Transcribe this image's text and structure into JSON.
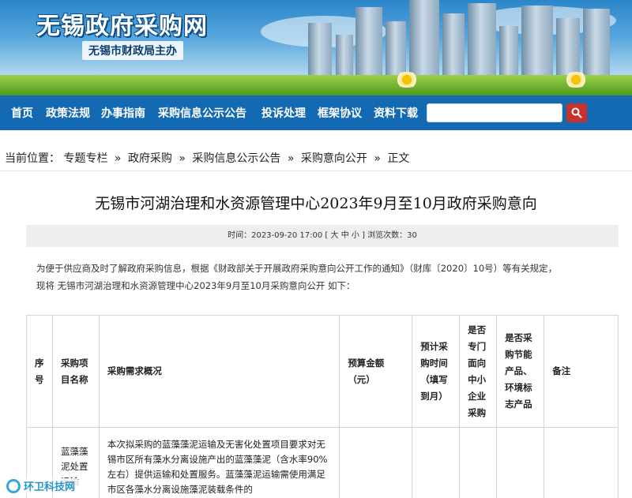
{
  "header": {
    "site_title": "无锡政府采购网",
    "site_subtitle": "无锡市财政局主办"
  },
  "nav": {
    "items": [
      "首页",
      "政策法规",
      "办事指南",
      "采购信息公示公告",
      "投诉处理",
      "框架协议",
      "资料下载"
    ],
    "search_placeholder": "",
    "search_icon": "search-icon"
  },
  "breadcrumb": {
    "prefix": "当前位置：",
    "items": [
      "专题专栏",
      "政府采购",
      "采购信息公示公告",
      "采购意向公开",
      "正文"
    ],
    "separator": "»"
  },
  "article": {
    "title": "无锡市河湖治理和水资源管理中心2023年9月至10月政府采购意向",
    "meta_time_label": "时间：",
    "meta_time": "2023-09-20 17:00",
    "meta_size_open": "[",
    "meta_size_big": "大",
    "meta_size_mid": "中",
    "meta_size_small": "小",
    "meta_size_close": "]",
    "meta_views_label": "浏览次数：",
    "meta_views": "30",
    "intro_line1": "为便于供应商及时了解政府采购信息，根据《财政部关于开展政府采购意向公开工作的通知》（财库〔2020〕10号）等有关规定，",
    "intro_line2": "现将 无锡市河湖治理和水资源管理中心2023年9月至10月采购意向公开 如下："
  },
  "table": {
    "headers": {
      "seq": "序号",
      "name": "采购项目名称",
      "demand": "采购需求概况",
      "budget": "预算金额（元）",
      "time": "预计采购时间（填写到月）",
      "sme": "是否专门面向中小企业采购",
      "green": "是否采购节能产品、环境标志产品",
      "note": "备注"
    },
    "rows": [
      {
        "seq": "",
        "name": "蓝藻藻泥处置运输",
        "demand": "本次拟采购的蓝藻藻泥运输及无害化处置项目要求对无锡市区所有藻水分离设施产出的蓝藻藻泥（含水率90%左右）提供运输和处置服务。蓝藻藻泥运输需使用满足市区各藻水分离设施藻泥装载条件的",
        "budget": "",
        "time": "",
        "sme": "",
        "green": "",
        "note": ""
      }
    ]
  },
  "watermark": {
    "text": "环卫科技网"
  },
  "colors": {
    "nav_bg": "#1469b3",
    "search_btn": "#c8322a",
    "meta_bg": "#eeeeee"
  }
}
